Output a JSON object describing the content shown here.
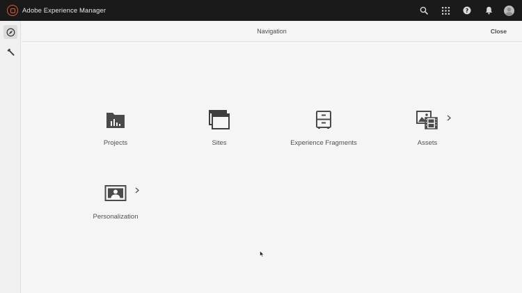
{
  "app": {
    "title": "Adobe Experience Manager"
  },
  "topbar": {
    "icons": [
      "search-icon",
      "apps-grid-icon",
      "help-icon",
      "notifications-bell-icon",
      "user-avatar"
    ]
  },
  "rail": {
    "items": [
      {
        "icon": "navigation-compass-icon",
        "active": true
      },
      {
        "icon": "tools-hammer-icon",
        "active": false
      }
    ]
  },
  "header": {
    "title": "Navigation",
    "close_label": "Close"
  },
  "tiles": [
    {
      "label": "Projects",
      "icon": "projects-folder-icon",
      "has_children": false
    },
    {
      "label": "Sites",
      "icon": "sites-windows-icon",
      "has_children": false
    },
    {
      "label": "Experience Fragments",
      "icon": "experience-fragments-cabinet-icon",
      "has_children": false
    },
    {
      "label": "Assets",
      "icon": "assets-media-icon",
      "has_children": true
    },
    {
      "label": "Personalization",
      "icon": "personalization-user-screen-icon",
      "has_children": true
    }
  ],
  "colors": {
    "topbar_bg": "#1a1a1a",
    "brand_accent": "#e05a32",
    "page_bg": "#f5f5f5",
    "icon": "#4a4a4a"
  }
}
